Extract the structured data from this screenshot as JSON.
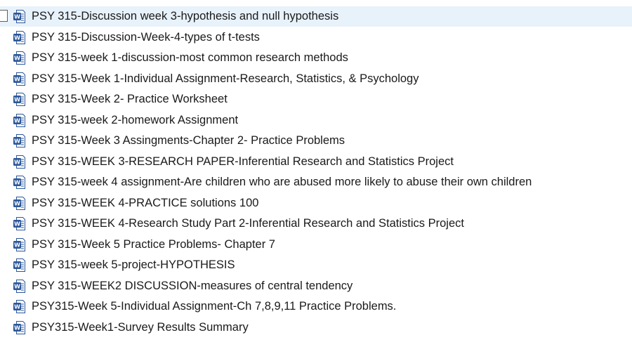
{
  "icons": {
    "file_icon": "word-document-icon",
    "icon_letter": "W",
    "icon_color": "#2b579a"
  },
  "colors": {
    "selected_row_background": "#e8f2fb"
  },
  "files": [
    {
      "name": "PSY 315-Discussion week 3-hypothesis and null hypothesis",
      "selected": true
    },
    {
      "name": "PSY 315-Discussion-Week-4-types of t-tests",
      "selected": false
    },
    {
      "name": "PSY 315-week 1-discussion-most common research methods",
      "selected": false
    },
    {
      "name": "PSY 315-Week 1-Individual Assignment-Research, Statistics, & Psychology",
      "selected": false
    },
    {
      "name": "PSY 315-Week 2- Practice Worksheet",
      "selected": false
    },
    {
      "name": "PSY 315-week 2-homework Assignment",
      "selected": false
    },
    {
      "name": "PSY 315-Week 3 Assingments-Chapter 2- Practice Problems",
      "selected": false
    },
    {
      "name": "PSY 315-WEEK 3-RESEARCH PAPER-Inferential Research and Statistics Project",
      "selected": false
    },
    {
      "name": "PSY 315-week 4 assignment-Are children who are abused more likely to abuse their own children",
      "selected": false
    },
    {
      "name": "PSY 315-WEEK 4-PRACTICE solutions 100",
      "selected": false
    },
    {
      "name": "PSY 315-WEEK 4-Research Study Part 2-Inferential Research and Statistics Project",
      "selected": false
    },
    {
      "name": "PSY 315-Week 5 Practice Problems- Chapter 7",
      "selected": false
    },
    {
      "name": "PSY 315-week 5-project-HYPOTHESIS",
      "selected": false
    },
    {
      "name": "PSY 315-WEEK2 DISCUSSION-measures of central tendency",
      "selected": false
    },
    {
      "name": "PSY315-Week 5-Individual Assignment-Ch 7,8,9,11 Practice Problems.",
      "selected": false
    },
    {
      "name": "PSY315-Week1-Survey Results Summary",
      "selected": false
    }
  ]
}
